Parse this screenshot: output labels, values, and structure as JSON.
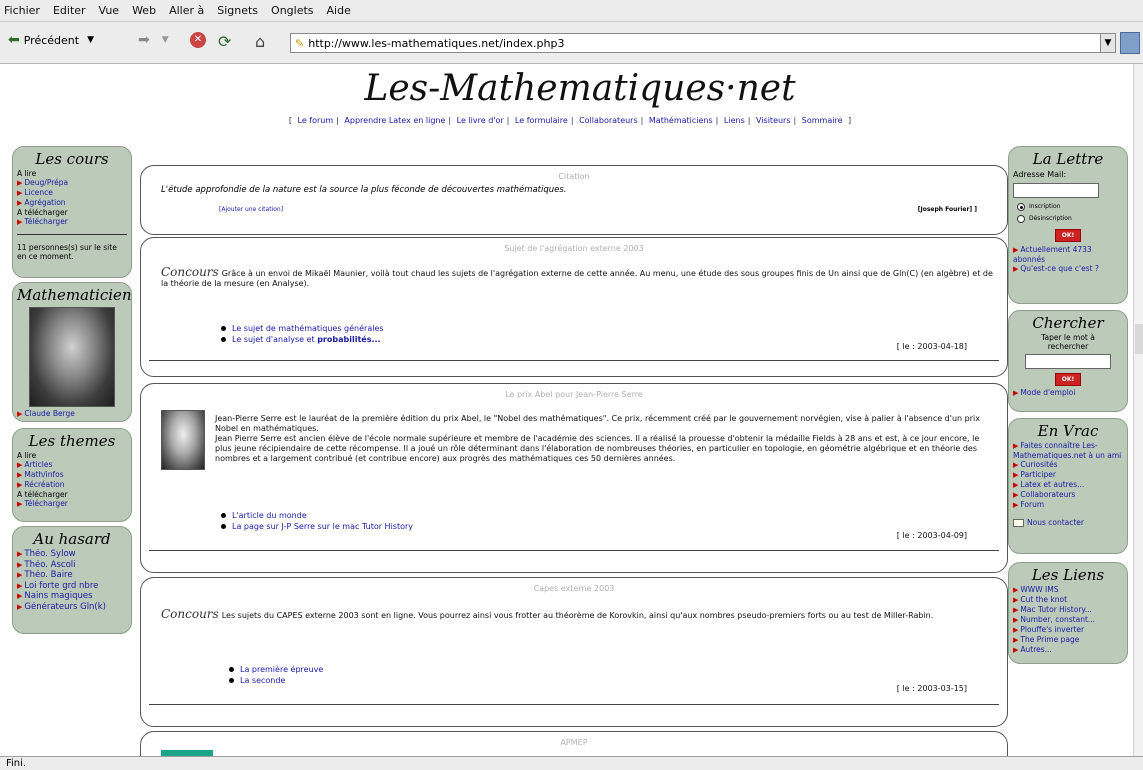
{
  "browser": {
    "menu": [
      "Fichier",
      "Editer",
      "Vue",
      "Web",
      "Aller à",
      "Signets",
      "Onglets",
      "Aide"
    ],
    "back_label": "Précédent",
    "url": "http://www.les-mathematiques.net/index.php3",
    "status": "Fini."
  },
  "site": {
    "title": "Les-Mathematiques·net",
    "nav": [
      "Le forum",
      "Apprendre Latex en ligne",
      "Le livre d'or",
      "Le formulaire",
      "Collaborateurs",
      "Mathématiciens",
      "Liens",
      "Visiteurs",
      "Sommaire"
    ]
  },
  "left": {
    "cours": {
      "title": "Les cours",
      "a_lire": "A lire",
      "items1": [
        "Deug/Prépa",
        "Licence",
        "Agrégation"
      ],
      "a_telecharger": "A télécharger",
      "items2": [
        "Télécharger"
      ],
      "online": "11 personnes(s) sur le site en ce moment."
    },
    "mathematicien": {
      "title": "Mathematicien",
      "name": "Claude Berge"
    },
    "themes": {
      "title": "Les themes",
      "a_lire": "A lire",
      "items1": [
        "Articles",
        "Math/infos",
        "Récréation"
      ],
      "a_telecharger": "A télécharger",
      "items2": [
        "Télécharger"
      ]
    },
    "hasard": {
      "title": "Au hasard",
      "items": [
        "Théo. Sylow",
        "Théo. Ascoli",
        "Théo. Baire",
        "Loi forte grd nbre",
        "Nains magiques",
        "Générateurs Gln(k)"
      ]
    }
  },
  "right": {
    "lettre": {
      "title": "La Lettre",
      "mail_label": "Adresse Mail:",
      "radio1": "Inscription",
      "radio2": "Désinscription",
      "ok": "OK!",
      "items": [
        "Actuellement 4733 abonnés",
        "Qu'est-ce que c'est ?"
      ]
    },
    "chercher": {
      "title": "Chercher",
      "prompt": "Taper le mot à rechercher",
      "ok": "OK!",
      "mode": "Mode d'emploi"
    },
    "vrac": {
      "title": "En Vrac",
      "items": [
        "Faites connaître Les-Mathematiques.net à un ami",
        "Curiosités",
        "Participer",
        "Latex et autres...",
        "Collaborateurs",
        "Forum"
      ],
      "contact": "Nous contacter"
    },
    "liens": {
      "title": "Les Liens",
      "items": [
        "WWW IMS",
        "Cut the knot",
        "Mac Tutor History...",
        "Number, constant...",
        "Plouffe's inverter",
        "The Prime page",
        "Autres..."
      ]
    }
  },
  "main": {
    "citation": {
      "head": "Citation",
      "text": "L'étude approfondie de la nature est la source la plus féconde de découvertes mathématiques.",
      "add": "[Ajouter une citation]",
      "author": "[Joseph Fourier] ]"
    },
    "agreg": {
      "head": "Sujet de l'agrégation externe 2003",
      "tag": "Concours",
      "text": "Grâce à un envoi de Mikaël Maunier, voilà tout chaud les sujets de l'agrégation externe de cette année. Au menu, une étude des sous groupes finis de Un ainsi que de Gln(C) (en algèbre) et de la théorie de la mesure (en Analyse).",
      "links": [
        "Le sujet de mathématiques générales",
        "Le sujet d'analyse et"
      ],
      "bold": "probabilités...",
      "date": "[ le : 2003-04-18]"
    },
    "abel": {
      "head": "Le prix Abel pour Jean-Pierre Serre",
      "p1": "Jean-Pierre Serre est le lauréat de la première édition du prix Abel, le \"Nobel des mathématiques\". Ce prix, récemment créé par le gouvernement norvégien, vise à palier à l'absence d'un prix Nobel en mathématiques.",
      "p2": "Jean Pierre Serre est ancien élève de l'école normale supérieure et membre de l'académie des sciences. Il a réalisé la prouesse d'obtenir la médaille Fields à 28 ans et est, à ce jour encore, le plus jeune récipiendaire de cette récompense. Il a joué un rôle déterminant dans l'élaboration de nombreuses théories, en particulier en topologie, en géométrie algébrique et en théorie des nombres et a largement contribué (et contribue encore) aux progrès des mathématiques ces 50 dernières années.",
      "links": [
        "L'article du monde",
        "La page sur J-P Serre sur le mac Tutor History"
      ],
      "date": "[ le : 2003-04-09]"
    },
    "capes": {
      "head": "Capes externe 2003",
      "tag": "Concours",
      "text": "Les sujets du CAPES externe 2003 sont en ligne. Vous pourrez ainsi vous frotter au théorème de Korovkin, ainsi qu'aux nombres pseudo-premiers forts ou au test de Miller-Rabin.",
      "links": [
        "La première épreuve",
        "La seconde"
      ],
      "date": "[ le : 2003-03-15]"
    },
    "apmep": {
      "head": "APMEP"
    }
  }
}
